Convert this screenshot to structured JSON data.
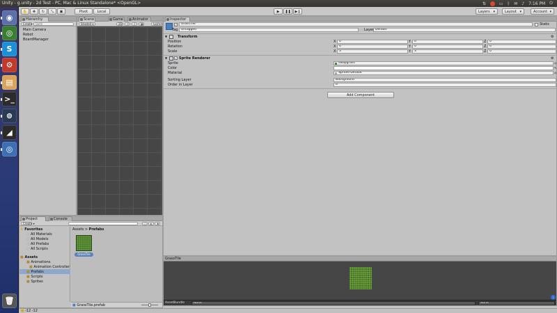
{
  "topbar": {
    "window_title": "Unity - g.unity - 2d Test - PC, Mac & Linux Standalone* <OpenGL>",
    "clock": "7:16 PM"
  },
  "launcher": {
    "items": [
      {
        "name": "dash-icon",
        "glyph": "◉",
        "color": "#5b6fa8"
      },
      {
        "name": "chrome-icon",
        "glyph": "◎",
        "color": "#3b7d33"
      },
      {
        "name": "skype-icon",
        "glyph": "S",
        "color": "#1d8fd6"
      },
      {
        "name": "settings-icon",
        "glyph": "⚙",
        "color": "#c0392b"
      },
      {
        "name": "files-icon",
        "glyph": "▤",
        "color": "#d9a35c"
      },
      {
        "name": "terminal-icon",
        "glyph": ">_",
        "color": "#2b2b2b"
      },
      {
        "name": "steam-icon",
        "glyph": "⊚",
        "color": "#2a3a55"
      },
      {
        "name": "unity-icon",
        "glyph": "◢",
        "color": "#2b2b2b"
      },
      {
        "name": "monodevelop-icon",
        "glyph": "◎",
        "color": "#3d6fb5"
      },
      {
        "name": "trash-icon",
        "glyph": "🗑",
        "color": "#555555"
      }
    ]
  },
  "toolbar": {
    "pivot": "Pivot",
    "local": "Local",
    "layers": "Layers",
    "layout": "Layout",
    "account": "Account"
  },
  "hierarchy": {
    "tab": "Hierarchy",
    "create": "Create",
    "search_placeholder": "Q▾All",
    "items": [
      "Main Camera",
      "Robot",
      "BoardManager"
    ]
  },
  "scene": {
    "tab_scene": "Scene",
    "tab_game": "Game",
    "tab_animator": "Animator",
    "shaded": "Shaded",
    "mode_2d": "2D",
    "gizmos": "Gizmos"
  },
  "inspector": {
    "tab": "Inspector",
    "object_name": "GrassTile",
    "static": "Static",
    "tag_label": "Tag",
    "tag_value": "Untagged",
    "layer_label": "Layer",
    "layer_value": "Default",
    "transform": {
      "title": "Transform",
      "rows": [
        {
          "label": "Position",
          "x": "0",
          "y": "0",
          "z": "0"
        },
        {
          "label": "Rotation",
          "x": "0",
          "y": "0",
          "z": "0"
        },
        {
          "label": "Scale",
          "x": "3",
          "y": "3",
          "z": "0"
        }
      ]
    },
    "sprite_renderer": {
      "title": "Sprite Renderer",
      "sprite_label": "Sprite",
      "sprite_value": "swapgrass",
      "color_label": "Color",
      "material_label": "Material",
      "material_value": "Sprites-Default",
      "sorting_layer_label": "Sorting Layer",
      "sorting_layer_value": "Background",
      "order_label": "Order in Layer",
      "order_value": "0"
    },
    "add_component": "Add Component"
  },
  "project": {
    "tab_project": "Project",
    "tab_console": "Console",
    "create": "Create",
    "favorites_title": "Favorites",
    "favorites": [
      "All Materials",
      "All Models",
      "All Prefabs",
      "All Scripts"
    ],
    "assets_title": "Assets",
    "tree": [
      "Animations",
      "Animation Controller",
      "Prefabs",
      "Scripts",
      "Sprites"
    ],
    "breadcrumb_root": "Assets",
    "breadcrumb_sep": ">",
    "breadcrumb_current": "Prefabs",
    "asset_name": "GrassTile",
    "footer_file": "GrassTile.prefab"
  },
  "preview": {
    "title": "GrassTile",
    "assetbundle_label": "AssetBundle",
    "assetbundle_value": "None",
    "variant_value": "None"
  },
  "status": {
    "text": "-12 -12"
  }
}
